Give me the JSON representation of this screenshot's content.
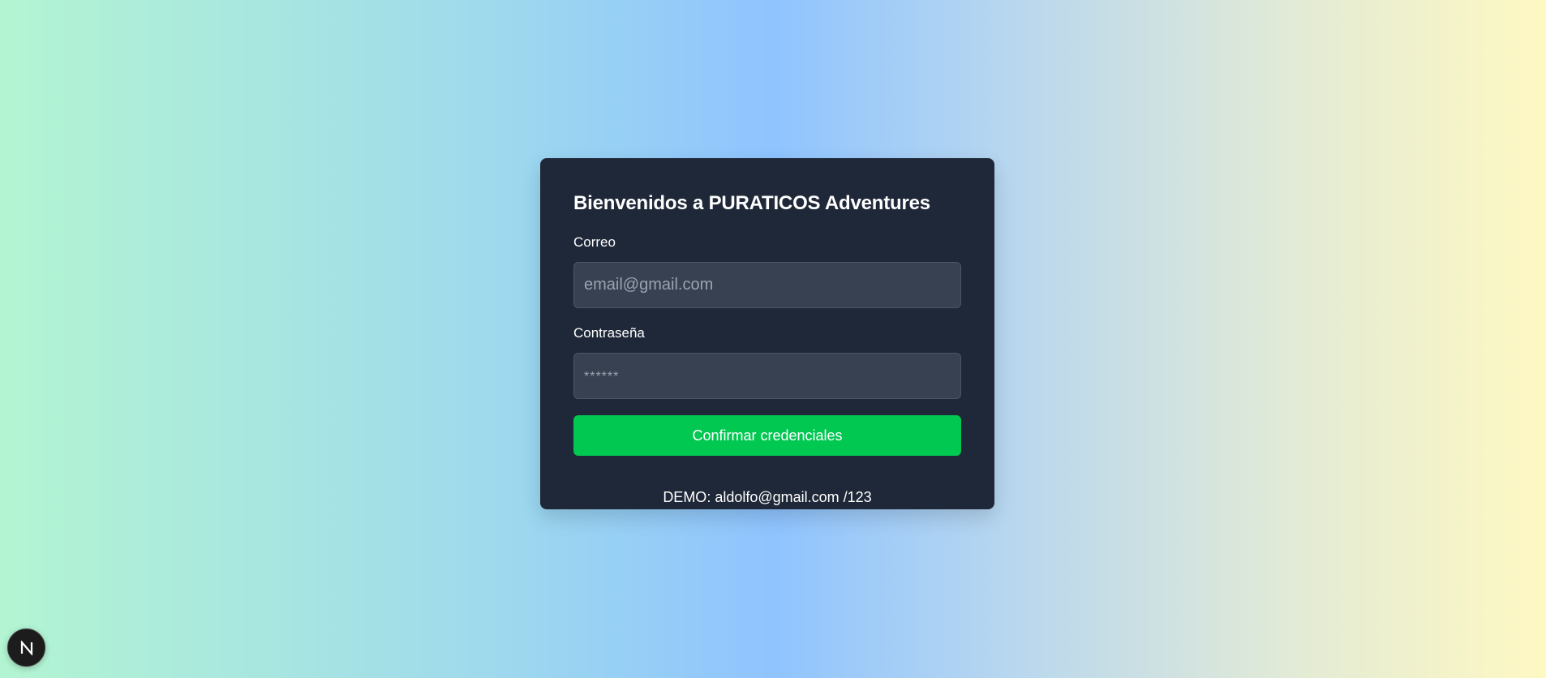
{
  "login": {
    "title": "Bienvenidos a PURATICOS Adventures",
    "email_label": "Correo",
    "email_placeholder": "email@gmail.com",
    "password_label": "Contraseña",
    "password_placeholder": "******",
    "submit_label": "Confirmar credenciales",
    "demo_text": "DEMO: aldolfo@gmail.com /123"
  },
  "dev_indicator": {
    "icon": "nextjs-logo-icon"
  },
  "colors": {
    "card_bg": "#1f2838",
    "input_bg": "#374151",
    "button_bg": "#00c851"
  }
}
